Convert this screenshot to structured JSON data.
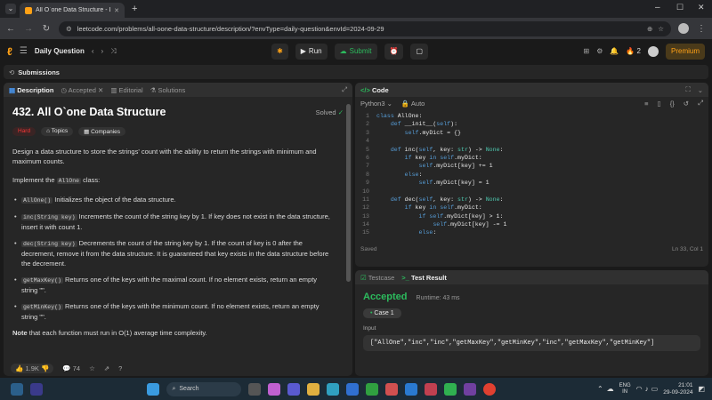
{
  "browser": {
    "tab_title": "All O`one Data Structure - Leet",
    "url": "leetcode.com/problems/all-oone-data-structure/description/?envType=daily-question&envId=2024-09-29"
  },
  "topbar": {
    "daily_label": "Daily Question",
    "run_label": "Run",
    "submit_label": "Submit",
    "streak": "2",
    "premium_label": "Premium"
  },
  "submissions_label": "Submissions",
  "left_tabs": [
    "Description",
    "Accepted",
    "Editorial",
    "Solutions"
  ],
  "problem": {
    "title": "432. All O`one Data Structure",
    "solved": "Solved",
    "difficulty": "Hard",
    "topics": "Topics",
    "companies": "Companies",
    "intro": "Design a data structure to store the strings' count with the ability to return the strings with minimum and maximum counts.",
    "implement_pre": "Implement the ",
    "implement_code": "AllOne",
    "implement_post": " class:",
    "bullets": [
      {
        "code": "AllOne()",
        "text": " Initializes the object of the data structure."
      },
      {
        "code": "inc(String key)",
        "text": " Increments the count of the string key by 1. If key does not exist in the data structure, insert it with count 1."
      },
      {
        "code": "dec(String key)",
        "text": " Decrements the count of the string key by 1. If the count of key is 0 after the decrement, remove it from the data structure. It is guaranteed that key exists in the data structure before the decrement."
      },
      {
        "code": "getMaxKey()",
        "text": " Returns one of the keys with the maximal count. If no element exists, return an empty string \"\"."
      },
      {
        "code": "getMinKey()",
        "text": " Returns one of the keys with the minimum count. If no element exists, return an empty string \"\"."
      }
    ],
    "note_bold": "Note",
    "note_text": " that each function must run in O(1) average time complexity.",
    "likes": "1.9K",
    "comments": "74"
  },
  "code_panel": {
    "title": "Code",
    "language": "Python3",
    "auto": "Auto",
    "saved": "Saved",
    "position": "Ln 33, Col 1",
    "lines": [
      "class AllOne:",
      "    def __init__(self):",
      "        self.myDict = {}",
      "",
      "    def inc(self, key: str) -> None:",
      "        if key in self.myDict:",
      "            self.myDict[key] += 1",
      "        else:",
      "            self.myDict[key] = 1",
      "",
      "    def dec(self, key: str) -> None:",
      "        if key in self.myDict:",
      "            if self.myDict[key] > 1:",
      "                self.myDict[key] -= 1",
      "            else:"
    ]
  },
  "result_panel": {
    "tab1": "Testcase",
    "tab2": "Test Result",
    "status": "Accepted",
    "runtime": "Runtime: 43 ms",
    "case": "Case 1",
    "input_label": "Input",
    "input_value": "[\"AllOne\",\"inc\",\"inc\",\"getMaxKey\",\"getMinKey\",\"inc\",\"getMaxKey\",\"getMinKey\"]"
  },
  "taskbar": {
    "search": "Search",
    "lang1": "ENG",
    "lang2": "IN",
    "time": "21:01",
    "date": "29-09-2024"
  },
  "colors": {
    "accent": "#ffa116",
    "green": "#2cbb5d",
    "hard": "#f63636"
  }
}
